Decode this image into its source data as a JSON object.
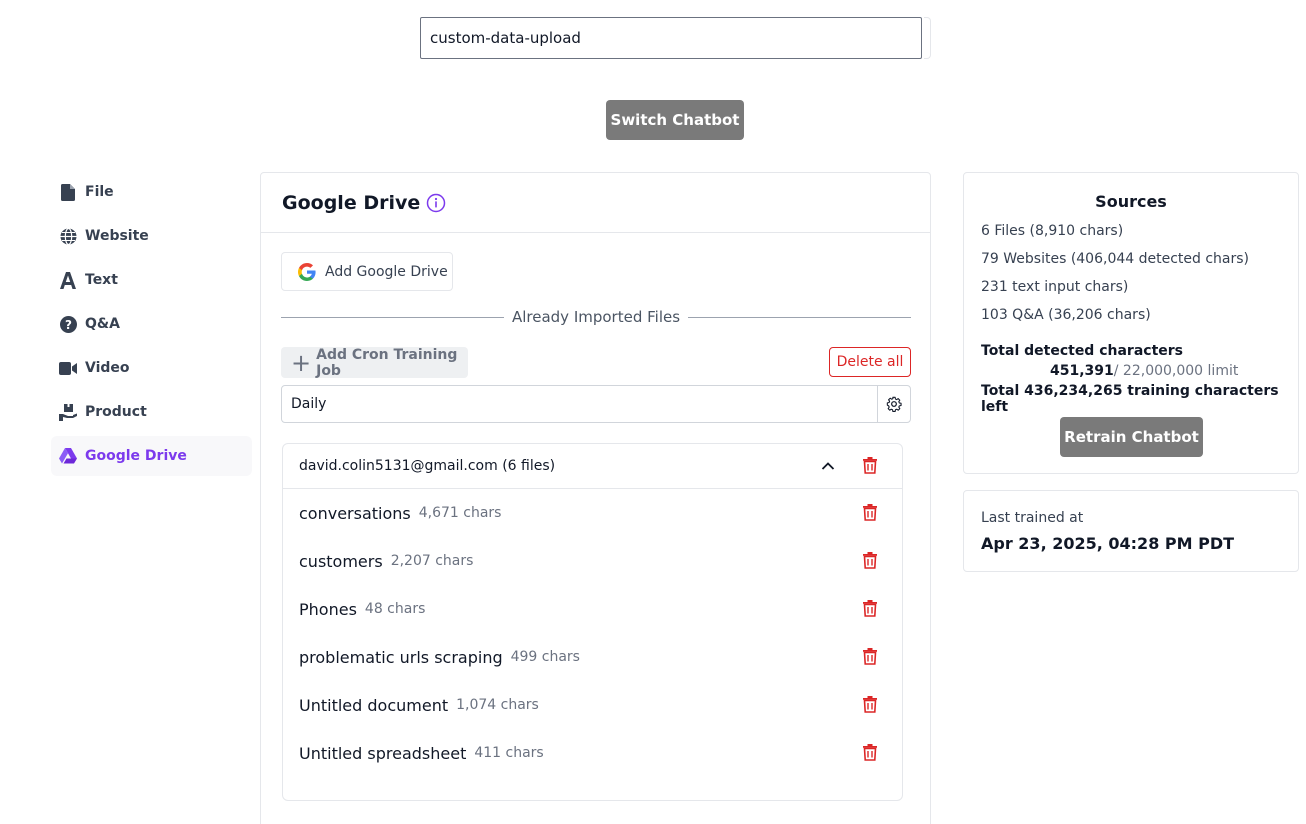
{
  "top": {
    "chatbot_value": "custom-data-upload",
    "switch_label": "Switch Chatbot"
  },
  "sidebar": {
    "items": [
      {
        "label": "File",
        "icon": "file-icon"
      },
      {
        "label": "Website",
        "icon": "globe-icon"
      },
      {
        "label": "Text",
        "icon": "text-icon"
      },
      {
        "label": "Q&A",
        "icon": "question-icon"
      },
      {
        "label": "Video",
        "icon": "video-icon"
      },
      {
        "label": "Product",
        "icon": "product-icon"
      },
      {
        "label": "Google Drive",
        "icon": "google-drive-icon",
        "active": true
      }
    ]
  },
  "main": {
    "title": "Google Drive",
    "add_button": "Add Google Drive",
    "divider_label": "Already Imported Files",
    "cron_button": "Add Cron Training Job",
    "delete_all": "Delete all",
    "frequency": "Daily",
    "account": {
      "name": "david.colin5131@gmail.com (6 files)",
      "files": [
        {
          "name": "conversations",
          "chars": "4,671 chars"
        },
        {
          "name": "customers",
          "chars": "2,207 chars"
        },
        {
          "name": "Phones",
          "chars": "48 chars"
        },
        {
          "name": "problematic urls scraping",
          "chars": "499 chars"
        },
        {
          "name": "Untitled document",
          "chars": "1,074 chars"
        },
        {
          "name": "Untitled spreadsheet",
          "chars": "411 chars"
        }
      ]
    }
  },
  "sources": {
    "title": "Sources",
    "lines": [
      "6 Files (8,910 chars)",
      "79 Websites (406,044 detected chars)",
      "231 text input chars)",
      "103 Q&A (36,206 chars)"
    ],
    "total_label": "Total detected characters",
    "total_value": "451,391",
    "total_limit": "/ 22,000,000 limit",
    "total_left": "Total 436,234,265 training characters left",
    "retrain_label": "Retrain Chatbot"
  },
  "last_trained": {
    "label": "Last trained at",
    "value": "Apr 23, 2025, 04:28 PM PDT"
  },
  "colors": {
    "accent": "#7c3aed",
    "danger": "#dc2626",
    "button_gray": "#7a7a7a"
  }
}
